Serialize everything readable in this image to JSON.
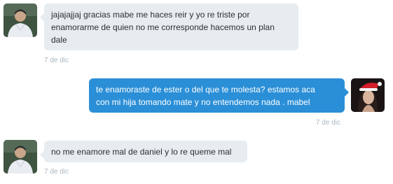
{
  "conversation": {
    "messages": [
      {
        "direction": "incoming",
        "avatar_icon": "user-avatar-icon",
        "lines": [
          "jajajajjaj gracias mabe me haces reir y yo re triste por",
          "enamorarme de quien no me corresponde hacemos un plan",
          "dale"
        ],
        "timestamp": "7 de dic"
      },
      {
        "direction": "outgoing",
        "avatar_icon": "user-avatar-santa-hat-icon",
        "lines": [
          "te enamoraste de ester o del que te molesta? estamos aca",
          "con mi hija tomando mate y no entendemos nada . mabel"
        ],
        "timestamp": "7 de dic"
      },
      {
        "direction": "incoming",
        "avatar_icon": "user-avatar-icon",
        "lines": [
          "no me enamore mal de daniel y lo re queme mal"
        ],
        "timestamp": "7 de dic"
      }
    ]
  },
  "colors": {
    "incoming_bubble": "#e6ecf0",
    "outgoing_bubble": "#2b8fd7",
    "timestamp_text": "#aab8c2"
  }
}
